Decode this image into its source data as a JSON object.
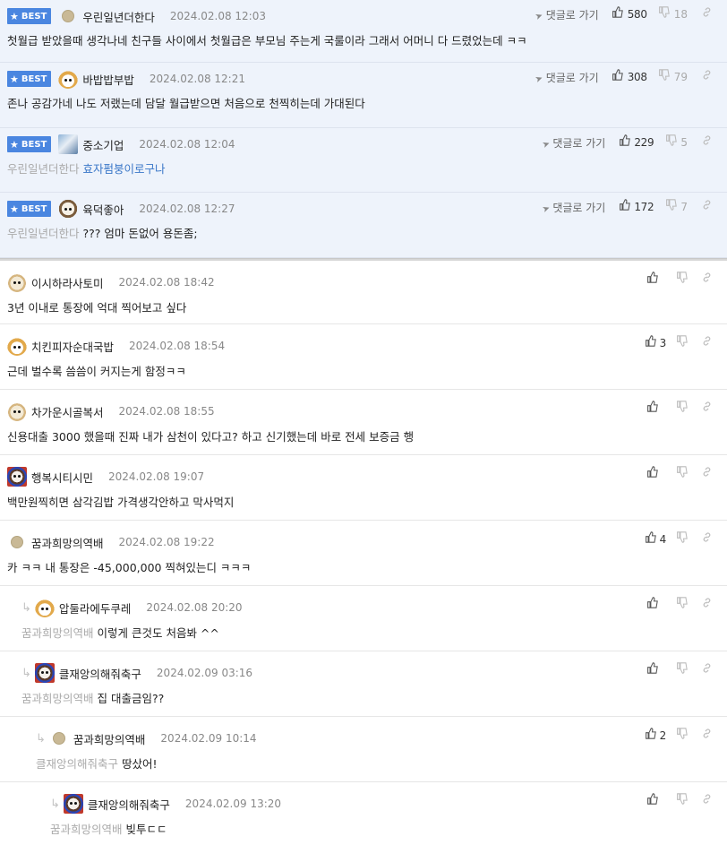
{
  "best": [
    {
      "nick": "우린일년더한다",
      "date": "2024.02.08 12:03",
      "avatar": "dot",
      "goto": "댓글로 가기",
      "up": "580",
      "down": "18",
      "mention": "",
      "text": "첫월급 받았을때 생각나네 친구들 사이에서 첫월급은 부모님 주는게 국룰이라 그래서 어머니 다 드렸었는데 ㅋㅋ",
      "highlight": ""
    },
    {
      "nick": "바밥밥부밥",
      "date": "2024.02.08 12:21",
      "avatar": "fox",
      "goto": "댓글로 가기",
      "up": "308",
      "down": "79",
      "mention": "",
      "text": "존나 공감가네 나도 저랬는데 담달 월급받으면 처음으로 천찍히는데 가대된다",
      "highlight": ""
    },
    {
      "nick": "중소기업",
      "date": "2024.02.08 12:04",
      "avatar": "blue",
      "goto": "댓글로 가기",
      "up": "229",
      "down": "5",
      "mention": "우린일년더한다",
      "text": "",
      "highlight": "효자펌붕이로구나"
    },
    {
      "nick": "육덕좋아",
      "date": "2024.02.08 12:27",
      "avatar": "puppy",
      "goto": "댓글로 가기",
      "up": "172",
      "down": "7",
      "mention": "우린일년더한다",
      "text": "??? 엄마 돈없어 용돈좀;",
      "highlight": ""
    }
  ],
  "best_badge": "BEST",
  "comments": [
    {
      "nick": "이시하라사토미",
      "date": "2024.02.08 18:42",
      "avatar": "dog",
      "up": "",
      "mention": "",
      "text": "3년 이내로 통장에 억대 찍어보고 싶다",
      "depth": 0
    },
    {
      "nick": "치킨피자순대국밥",
      "date": "2024.02.08 18:54",
      "avatar": "fox",
      "up": "3",
      "mention": "",
      "text": "근데 벌수록 씀씀이 커지는게 함정ㅋㅋ",
      "depth": 0
    },
    {
      "nick": "차가운시골복서",
      "date": "2024.02.08 18:55",
      "avatar": "dog",
      "up": "",
      "mention": "",
      "text": "신용대출 3000 했을때 진짜 내가 삼천이 있다고? 하고 신기했는데 바로 전세 보증금 행",
      "depth": 0
    },
    {
      "nick": "행복시티시민",
      "date": "2024.02.08 19:07",
      "avatar": "bear",
      "up": "",
      "mention": "",
      "text": "백만원찍히면 삼각김밥 가격생각안하고 막사먹지",
      "depth": 0
    },
    {
      "nick": "꿈과희망의역배",
      "date": "2024.02.08 19:22",
      "avatar": "dot",
      "up": "4",
      "mention": "",
      "text": "카 ㅋㅋ 내 통장은 -45,000,000 찍혀있는디 ㅋㅋㅋ",
      "depth": 0
    },
    {
      "nick": "압둘라에두쿠레",
      "date": "2024.02.08 20:20",
      "avatar": "fox",
      "up": "",
      "mention": "꿈과희망의역배",
      "text": "이렇게 큰것도 처음봐 ^^",
      "depth": 1
    },
    {
      "nick": "클재앙의해줘축구",
      "date": "2024.02.09 03:16",
      "avatar": "bear",
      "up": "",
      "mention": "꿈과희망의역배",
      "text": "집 대출금임??",
      "depth": 1
    },
    {
      "nick": "꿈과희망의역배",
      "date": "2024.02.09 10:14",
      "avatar": "dot",
      "up": "2",
      "mention": "클재앙의해줘축구",
      "text": "땅샀어!",
      "depth": 2
    },
    {
      "nick": "클재앙의해줘축구",
      "date": "2024.02.09 13:20",
      "avatar": "bear",
      "up": "",
      "mention": "꿈과희망의역배",
      "text": "빚투ㄷㄷ",
      "depth": 3
    }
  ],
  "icons": {
    "thumb_up": "thumb-up-icon",
    "thumb_down": "thumb-down-icon",
    "link": "link-icon",
    "plane": "send-icon",
    "star": "star-icon",
    "reply": "reply-arrow-icon"
  },
  "colors": {
    "best_bg": "#eef3fb",
    "badge": "#4a86e0",
    "highlight": "#3a77c8"
  }
}
